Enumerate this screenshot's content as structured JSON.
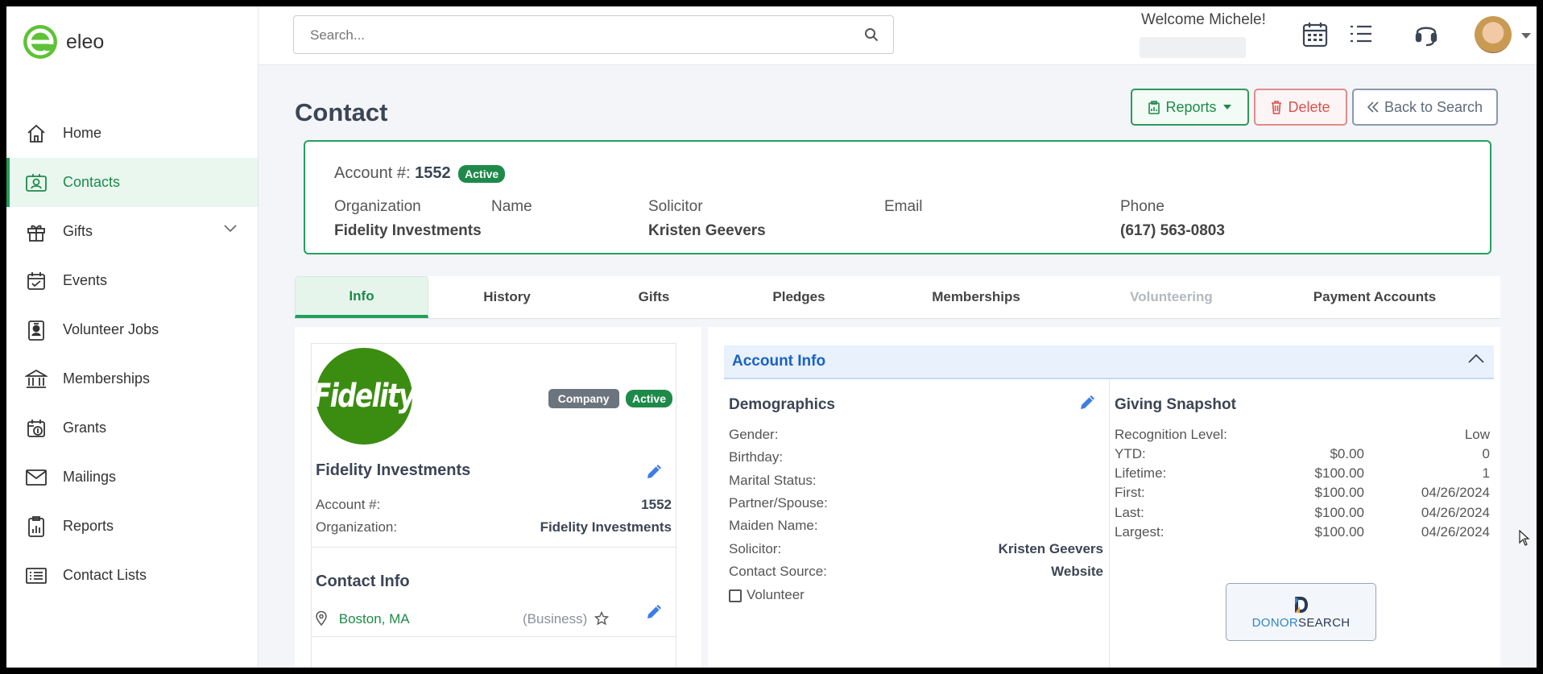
{
  "brand": {
    "name": "eleo"
  },
  "sidebar": {
    "items": [
      {
        "label": "Home",
        "icon": "home-icon"
      },
      {
        "label": "Contacts",
        "icon": "contact-card-icon",
        "active": true
      },
      {
        "label": "Gifts",
        "icon": "gift-icon",
        "expandable": true
      },
      {
        "label": "Events",
        "icon": "calendar-check-icon"
      },
      {
        "label": "Volunteer Jobs",
        "icon": "badge-icon"
      },
      {
        "label": "Memberships",
        "icon": "bank-icon"
      },
      {
        "label": "Grants",
        "icon": "money-calendar-icon"
      },
      {
        "label": "Mailings",
        "icon": "envelope-icon"
      },
      {
        "label": "Reports",
        "icon": "clipboard-chart-icon"
      },
      {
        "label": "Contact Lists",
        "icon": "list-icon"
      }
    ]
  },
  "topbar": {
    "search_placeholder": "Search...",
    "welcome": "Welcome Michele!"
  },
  "page": {
    "title": "Contact",
    "buttons": {
      "reports": "Reports",
      "delete": "Delete",
      "back": "Back to Search"
    }
  },
  "summary": {
    "account_label": "Account #:",
    "account_number": "1552",
    "status": "Active",
    "columns": [
      {
        "label": "Organization",
        "value": "Fidelity Investments"
      },
      {
        "label": "Name",
        "value": ""
      },
      {
        "label": "Solicitor",
        "value": "Kristen Geevers"
      },
      {
        "label": "Email",
        "value": ""
      },
      {
        "label": "Phone",
        "value": "(617) 563-0803"
      }
    ]
  },
  "tabs": [
    {
      "label": "Info",
      "active": true
    },
    {
      "label": "History"
    },
    {
      "label": "Gifts"
    },
    {
      "label": "Pledges"
    },
    {
      "label": "Memberships"
    },
    {
      "label": "Volunteering",
      "disabled": true
    },
    {
      "label": "Payment Accounts"
    }
  ],
  "profile": {
    "logo_text": "Fidelity",
    "type_badge": "Company",
    "status_badge": "Active",
    "name": "Fidelity Investments",
    "account_label": "Account #:",
    "account_value": "1552",
    "org_label": "Organization:",
    "org_value": "Fidelity Investments",
    "contact_info_title": "Contact Info",
    "location": "Boston, MA",
    "location_type": "(Business)"
  },
  "account_info": {
    "title": "Account Info",
    "demographics": {
      "title": "Demographics",
      "rows": [
        {
          "label": "Gender:",
          "value": ""
        },
        {
          "label": "Birthday:",
          "value": ""
        },
        {
          "label": "Marital Status:",
          "value": ""
        },
        {
          "label": "Partner/Spouse:",
          "value": ""
        },
        {
          "label": "Maiden Name:",
          "value": ""
        },
        {
          "label": "Solicitor:",
          "value": "Kristen Geevers"
        },
        {
          "label": "Contact Source:",
          "value": "Website"
        }
      ],
      "volunteer_label": "Volunteer"
    },
    "giving": {
      "title": "Giving Snapshot",
      "recognition_label": "Recognition Level:",
      "recognition_value": "Low",
      "rows": [
        {
          "label": "YTD:",
          "amount": "$0.00",
          "extra": "0"
        },
        {
          "label": "Lifetime:",
          "amount": "$100.00",
          "extra": "1"
        },
        {
          "label": "First:",
          "amount": "$100.00",
          "extra": "04/26/2024"
        },
        {
          "label": "Last:",
          "amount": "$100.00",
          "extra": "04/26/2024"
        },
        {
          "label": "Largest:",
          "amount": "$100.00",
          "extra": "04/26/2024"
        }
      ],
      "donorsearch_part1": "DONOR",
      "donorsearch_part2": "SEARCH"
    }
  },
  "colors": {
    "primary_green": "#21a05a",
    "link_blue": "#1a62c7",
    "danger": "#d9534f"
  }
}
